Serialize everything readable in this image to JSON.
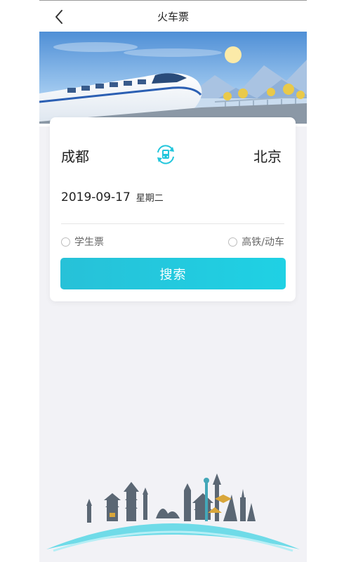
{
  "header": {
    "title": "火车票"
  },
  "route": {
    "from_city": "成都",
    "to_city": "北京"
  },
  "date": {
    "value": "2019-09-17",
    "weekday": "星期二"
  },
  "options": {
    "student_ticket": {
      "label": "学生票",
      "checked": false
    },
    "high_speed": {
      "label": "高铁/动车",
      "checked": false
    }
  },
  "search": {
    "label": "搜索"
  },
  "icons": {
    "back": "chevron-left-icon",
    "swap": "swap-train-icon"
  },
  "colors": {
    "accent": "#22c6dc",
    "background": "#f2f2f6"
  }
}
